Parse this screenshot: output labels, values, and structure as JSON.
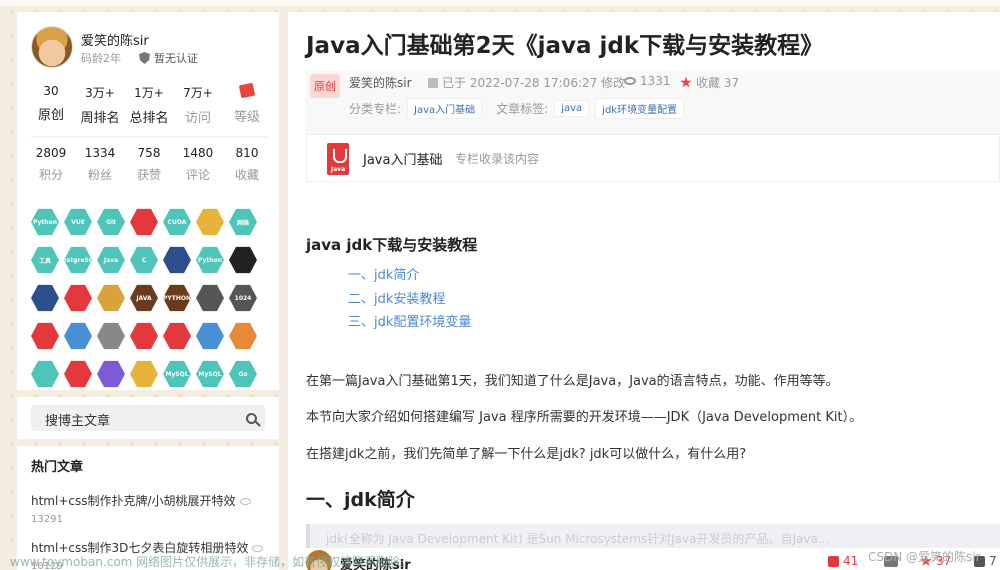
{
  "profile": {
    "name": "爱笑的陈sir",
    "age": "码龄2年",
    "cert": "暂无认证",
    "stats_row1": [
      {
        "num": "30",
        "label": "原创"
      },
      {
        "num": "3万+",
        "label": "周排名"
      },
      {
        "num": "1万+",
        "label": "总排名"
      },
      {
        "num": "7万+",
        "label": "访问"
      },
      {
        "num": "",
        "label": "等级"
      }
    ],
    "stats_row2": [
      {
        "num": "2809",
        "label": "积分"
      },
      {
        "num": "1334",
        "label": "粉丝"
      },
      {
        "num": "758",
        "label": "获赞"
      },
      {
        "num": "1480",
        "label": "评论"
      },
      {
        "num": "810",
        "label": "收藏"
      }
    ],
    "badges": [
      {
        "text": "Python",
        "color": "#4fc4b8"
      },
      {
        "text": "VUE",
        "color": "#4fc4b8"
      },
      {
        "text": "Git",
        "color": "#4fc4b8"
      },
      {
        "text": "",
        "color": "#e4393c"
      },
      {
        "text": "CUDA",
        "color": "#4fc4b8"
      },
      {
        "text": "",
        "color": "#e8b33a"
      },
      {
        "text": "网络",
        "color": "#4fc4b8"
      },
      {
        "text": "工具",
        "color": "#4fc4b8"
      },
      {
        "text": "PostgreSQL",
        "color": "#4fc4b8"
      },
      {
        "text": "Java",
        "color": "#4fc4b8"
      },
      {
        "text": "C",
        "color": "#4fc4b8"
      },
      {
        "text": "",
        "color": "#2d4e8c"
      },
      {
        "text": "Python",
        "color": "#4fc4b8"
      },
      {
        "text": "",
        "color": "#222222"
      },
      {
        "text": "",
        "color": "#2d4e8c"
      },
      {
        "text": "",
        "color": "#e4393c"
      },
      {
        "text": "",
        "color": "#d9a23a"
      },
      {
        "text": "JAVA",
        "color": "#6b3a1c"
      },
      {
        "text": "PYTHON",
        "color": "#6b3a1c"
      },
      {
        "text": "",
        "color": "#555555"
      },
      {
        "text": "1024",
        "color": "#555555"
      },
      {
        "text": "",
        "color": "#e4393c"
      },
      {
        "text": "",
        "color": "#4a90d6"
      },
      {
        "text": "",
        "color": "#888888"
      },
      {
        "text": "",
        "color": "#e4393c"
      },
      {
        "text": "",
        "color": "#e4393c"
      },
      {
        "text": "",
        "color": "#4a90d6"
      },
      {
        "text": "",
        "color": "#e8893a"
      },
      {
        "text": "",
        "color": "#4fc4b8"
      },
      {
        "text": "",
        "color": "#e4393c"
      },
      {
        "text": "",
        "color": "#7b5bd6"
      },
      {
        "text": "",
        "color": "#e8b33a"
      },
      {
        "text": "MySQL",
        "color": "#4fc4b8"
      },
      {
        "text": "MySQL",
        "color": "#4fc4b8"
      },
      {
        "text": "Go",
        "color": "#4fc4b8"
      }
    ]
  },
  "search": {
    "placeholder": "搜博主文章"
  },
  "hot": {
    "title": "热门文章",
    "items": [
      {
        "title": "html+css制作扑克牌/小胡桃展开特效",
        "views": "13291"
      },
      {
        "title": "html+css制作3D七夕表白旋转相册特效",
        "views": "10129"
      }
    ]
  },
  "article": {
    "title": "Java入门基础第2天《java jdk下载与安装教程》",
    "orig_badge": "原创",
    "author": "爱笑的陈sir",
    "date": "已于 2022-07-28 17:06:27 修改",
    "views": "1331",
    "fav": "收藏 37",
    "category_label": "分类专栏:",
    "category_tag": "Java入门基础",
    "tag_label": "文章标签:",
    "tags": [
      "java",
      "jdk环境变量配置"
    ],
    "column_name": "Java入门基础",
    "column_desc": "专栏收录该内容",
    "toc_title": "java jdk下载与安装教程",
    "toc": [
      "一、jdk简介",
      "二、jdk安装教程",
      "三、jdk配置环境变量"
    ],
    "paragraphs": [
      "在第一篇Java入门基础第1天，我们知道了什么是Java，Java的语言特点，功能、作用等等。",
      "本节向大家介绍如何搭建编写 Java 程序所需要的开发环境——JDK（Java Development Kit）。",
      "在搭建jdk之前，我们先简单了解一下什么是jdk? jdk可以做什么，有什么用?"
    ],
    "h1": "一、jdk简介",
    "quote": "jdk(全称为 Java Development Kit) 是Sun Microsystems针对Java开发员的产品。自Java..."
  },
  "bottom": {
    "author": "爱笑的陈sir",
    "likes": "41",
    "favs": "37",
    "share": "7"
  },
  "watermark": "www.toymoban.com 网络图片仅供展示，非存储，如有侵权请联系删除。",
  "csdn": "CSDN @爱笑的陈sir"
}
